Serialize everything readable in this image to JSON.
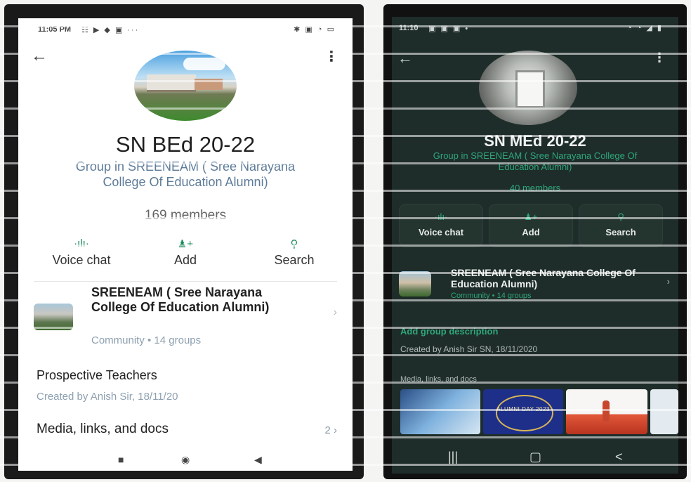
{
  "phone1": {
    "status_time": "11:05 PM",
    "status_icons": "☷ ▶ ◆ ▣ ···",
    "status_right": "✱ ▣ ◔ ▭",
    "group_title": "SN BEd 20-22",
    "group_subtitle": "Group in SREENEAM ( Sree Narayana College Of Education Alumni)",
    "members": "169 members",
    "actions": [
      {
        "label": "Voice chat",
        "icon": "voice-icon"
      },
      {
        "label": "Add",
        "icon": "add-person-icon"
      },
      {
        "label": "Search",
        "icon": "search-icon"
      }
    ],
    "community_name": "SREENEAM ( Sree Narayana College Of Education Alumni)",
    "community_meta": "Community • 14 groups",
    "description": "Prospective Teachers",
    "created": "Created by Anish Sir, 18/11/20",
    "media_label": "Media, links, and docs",
    "media_count": "2 ›"
  },
  "phone2": {
    "status_time": "11:10",
    "status_icons": "▣ ▣ ▣ •",
    "status_right": "◔ ◔ ◢ ▮",
    "group_title": "SN MEd 20-22",
    "group_subtitle": "Group in SREENEAM ( Sree Narayana College Of Education Alumni)",
    "members": "40 members",
    "actions": [
      {
        "label": "Voice chat",
        "icon": "voice-icon"
      },
      {
        "label": "Add",
        "icon": "add-person-icon"
      },
      {
        "label": "Search",
        "icon": "search-icon"
      }
    ],
    "community_name": "SREENEAM ( Sree Narayana College Of Education Alumni)",
    "community_meta": "Community • 14 groups",
    "add_description": "Add group description",
    "created": "Created by Anish Sir SN, 18/11/2020",
    "media_label": "Media, links, and docs",
    "media_thumb_caption": "ALUMNI DAY 2023"
  },
  "colors": {
    "accent_green": "#1a8a5a",
    "dark_accent": "#2fa67a",
    "dark_bg": "#1e2d2a"
  }
}
